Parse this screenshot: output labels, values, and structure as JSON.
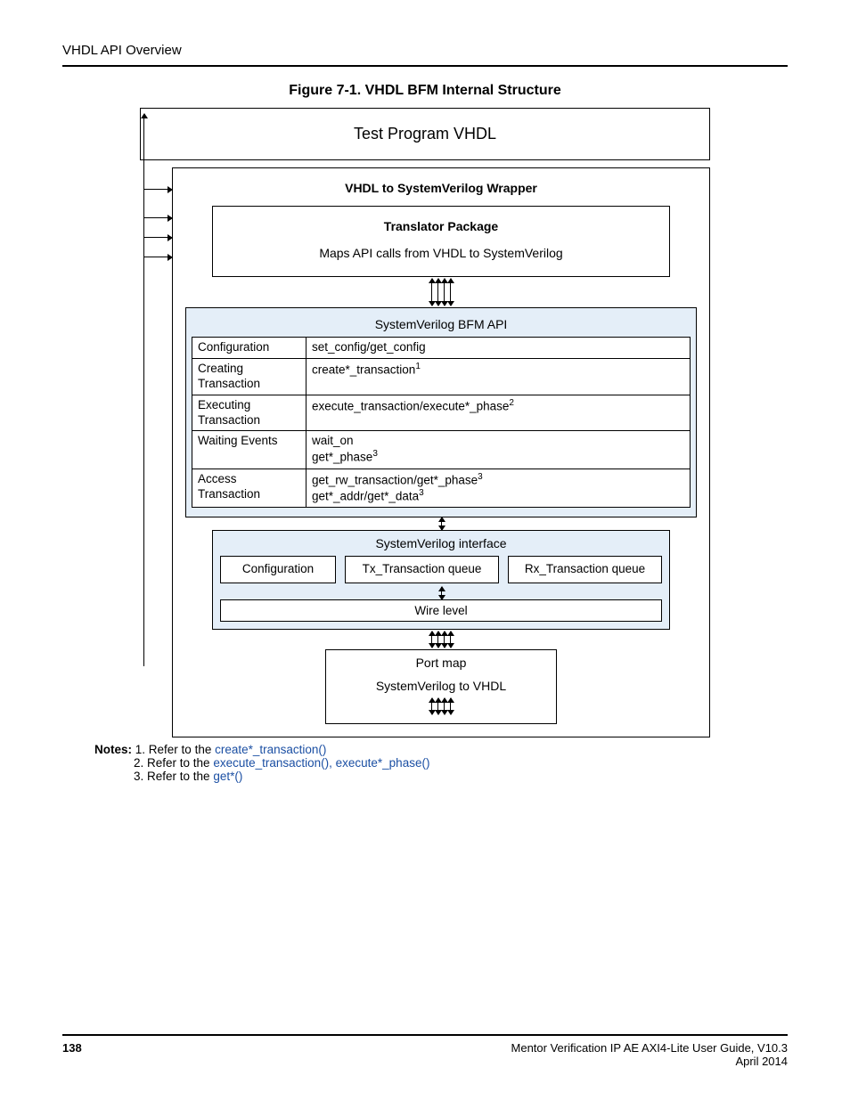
{
  "header": {
    "section": "VHDL API Overview"
  },
  "figure": {
    "title": "Figure 7-1. VHDL BFM Internal Structure",
    "top_box": "Test Program VHDL",
    "wrapper_title": "VHDL to SystemVerilog Wrapper",
    "translator": {
      "title": "Translator Package",
      "subtitle": "Maps API calls from VHDL to SystemVerilog"
    },
    "bfm": {
      "title": "SystemVerilog BFM API",
      "rows": [
        {
          "left": "Configuration",
          "right": "set_config/get_config"
        },
        {
          "left": "Creating Transaction",
          "right": "create*_transaction",
          "sup": "1"
        },
        {
          "left": "Executing Transaction",
          "right": "execute_transaction/execute*_phase",
          "sup": "2"
        },
        {
          "left": "Waiting Events",
          "right_a": "wait_on",
          "right_b": "get*_phase",
          "sup_b": "3"
        },
        {
          "left": "Access Transaction",
          "right_a": "get_rw_transaction/get*_phase",
          "sup_a": "3",
          "right_b": "get*_addr/get*_data",
          "sup_b": "3"
        }
      ]
    },
    "sv_iface": {
      "title": "SystemVerilog interface",
      "config": "Configuration",
      "tx": "Tx_Transaction queue",
      "rx": "Rx_Transaction queue",
      "wire": "Wire level"
    },
    "portmap": {
      "title": "Port map",
      "subtitle": "SystemVerilog to VHDL"
    }
  },
  "notes": {
    "label": "Notes:",
    "n1_a": "1. Refer to the ",
    "n1_link": "create*_transaction()",
    "n2_a": "2. Refer to the ",
    "n2_link": "execute_transaction(), execute*_phase()",
    "n3_a": "3. Refer to the ",
    "n3_link": "get*()"
  },
  "footer": {
    "page": "138",
    "guide": "Mentor Verification IP AE AXI4-Lite User Guide, V10.3",
    "date": "April 2014"
  }
}
